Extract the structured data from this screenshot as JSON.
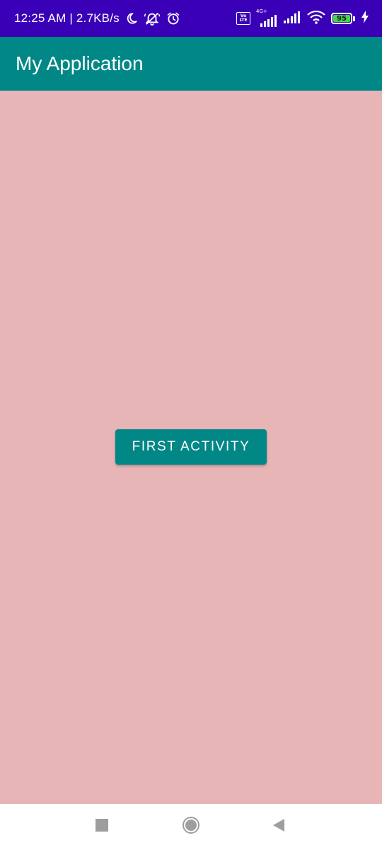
{
  "status_bar": {
    "time_and_speed": "12:25 AM | 2.7KB/s",
    "icons": [
      "moon-icon",
      "notifications-off-icon",
      "alarm-icon",
      "volte-icon",
      "signal-4g-icon",
      "signal-icon",
      "wifi-icon",
      "battery-icon",
      "charging-icon"
    ],
    "volte_top": "Vo",
    "volte_bottom": "LTE",
    "network_type": "4G+",
    "battery_level": "95",
    "colors": {
      "background": "#3a00b8",
      "battery_fill": "#43d64d"
    }
  },
  "app_bar": {
    "title": "My Application",
    "color": "#018786"
  },
  "main": {
    "background": "#e7b5b6",
    "button_label": "First Activity",
    "button_color": "#018786"
  },
  "nav_bar": {
    "buttons": [
      "recents-icon",
      "home-icon",
      "back-icon"
    ]
  }
}
